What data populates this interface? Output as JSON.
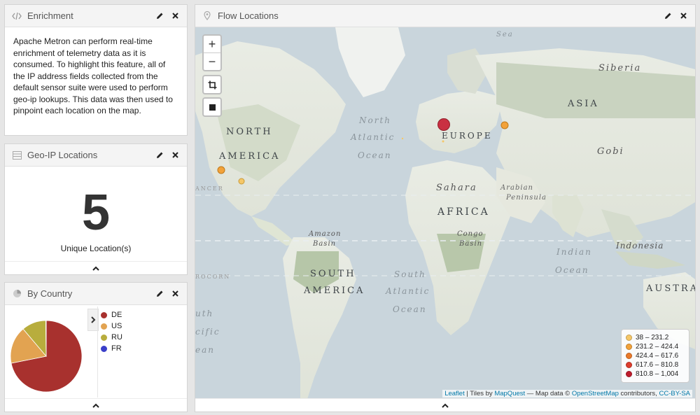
{
  "enrichment": {
    "title": "Enrichment",
    "text": "Apache Metron can perform real-time enrichment of telemetry data as it is consumed. To highlight this feature, all of the IP address fields collected from the default sensor suite were used to perform geo-ip lookups. This data was then used to pinpoint each location on the map."
  },
  "geoip": {
    "title": "Geo-IP Locations",
    "count": "5",
    "subtitle": "Unique Location(s)"
  },
  "by_country": {
    "title": "By Country",
    "legend": [
      {
        "label": "DE",
        "color": "#a8312e"
      },
      {
        "label": "US",
        "color": "#e2a351"
      },
      {
        "label": "RU",
        "color": "#b8ad3d"
      },
      {
        "label": "FR",
        "color": "#3a3fc9"
      }
    ]
  },
  "chart_data": {
    "type": "pie",
    "categories": [
      "DE",
      "US",
      "RU",
      "FR"
    ],
    "values": [
      72,
      17,
      11,
      0.2
    ],
    "colors": [
      "#a8312e",
      "#e2a351",
      "#b8ad3d",
      "#3a3fc9"
    ],
    "legend_position": "right"
  },
  "flow": {
    "title": "Flow Locations",
    "zoom_in": "+",
    "zoom_out": "−",
    "labels": {
      "sea": "Sea",
      "siberia": "Siberia",
      "asia": "ASIA",
      "north": "NORTH",
      "america": "AMERICA",
      "north_atl_1": "North",
      "north_atl_2": "Atlantic",
      "north_atl_3": "Ocean",
      "europe": "EUROPE",
      "gobi": "Gobi",
      "sahara": "Sahara",
      "arabian_1": "Arabian",
      "arabian_2": "Peninsula",
      "africa": "AFRICA",
      "amazon_1": "Amazon",
      "amazon_2": "Basin",
      "congo_1": "Congo",
      "congo_2": "Basin",
      "indian_1": "Indian",
      "indian_2": "Ocean",
      "indonesia": "Indonesia",
      "south_1": "SOUTH",
      "south_2": "AMERICA",
      "south_atl_1": "South",
      "south_atl_2": "Atlantic",
      "south_atl_3": "Ocean",
      "australia": "AUSTRAL",
      "left_1": "ANCER",
      "left_2": "ROCORN",
      "left_3": "uth",
      "left_4": "cific",
      "left_5": "ean"
    },
    "legend": [
      {
        "label": "38 – 231.2",
        "color": "#f5c768"
      },
      {
        "label": "231.2 – 424.4",
        "color": "#f2a23a"
      },
      {
        "label": "424.4 – 617.6",
        "color": "#ea7a2a"
      },
      {
        "label": "617.6 – 810.8",
        "color": "#dd3d2c"
      },
      {
        "label": "810.8 – 1,004",
        "color": "#bf1d2d"
      }
    ],
    "attribution": {
      "leaflet": "Leaflet",
      "sep1": " | Tiles by ",
      "mapquest": "MapQuest",
      "sep2": " — Map data © ",
      "osm": "OpenStreetMap",
      "sep3": " contributors, ",
      "license": "CC-BY-SA"
    }
  }
}
